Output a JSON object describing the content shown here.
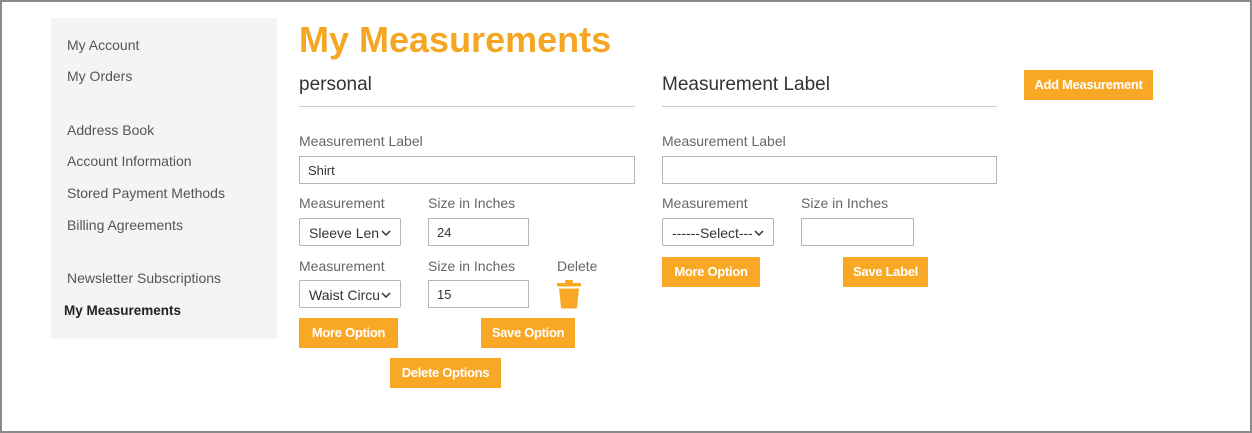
{
  "sidebar": {
    "items": [
      {
        "label": "My Account"
      },
      {
        "label": "My Orders"
      },
      {
        "label": "Address Book"
      },
      {
        "label": "Account Information"
      },
      {
        "label": "Stored Payment Methods"
      },
      {
        "label": "Billing Agreements"
      },
      {
        "label": "Newsletter Subscriptions"
      },
      {
        "label": "My Measurements",
        "active": true
      }
    ]
  },
  "page": {
    "title": "My Measurements"
  },
  "left_form": {
    "section_title": "personal",
    "label_field_label": "Measurement Label",
    "label_value": "Shirt",
    "rows": [
      {
        "measurement_label": "Measurement",
        "measurement_value": "Sleeve Length",
        "size_label": "Size in Inches",
        "size_value": "24"
      },
      {
        "measurement_label": "Measurement",
        "measurement_value": "Waist Circumference",
        "size_label": "Size in Inches",
        "size_value": "15",
        "delete_label": "Delete"
      }
    ],
    "more_option_label": "More Option",
    "save_option_label": "Save Option",
    "delete_options_label": "Delete Options"
  },
  "right_form": {
    "section_title": "Measurement Label",
    "label_field_label": "Measurement Label",
    "label_value": "",
    "measurement_label": "Measurement",
    "measurement_value": "------Select------",
    "size_label": "Size in Inches",
    "size_value": "",
    "more_option_label": "More Option",
    "save_label_label": "Save Label"
  },
  "add_measurement_label": "Add Measurement",
  "colors": {
    "accent": "#f5a623",
    "button": "#f9a825",
    "sidebar_bg": "#f4f4f4"
  },
  "icons": {
    "select_arrow": "chevron-down-icon",
    "delete": "trash-icon"
  }
}
